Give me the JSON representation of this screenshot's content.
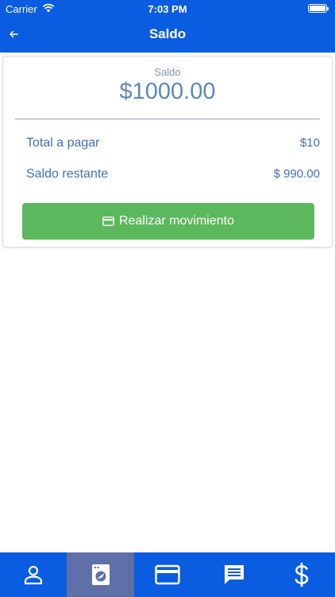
{
  "status_bar": {
    "carrier": "Carrier",
    "time": "7:03 PM"
  },
  "nav": {
    "title": "Saldo"
  },
  "balance": {
    "label": "Saldo",
    "value": "$1000.00"
  },
  "rows": [
    {
      "label": "Total a pagar",
      "value": "$10"
    },
    {
      "label": "Saldo restante",
      "value": "$ 990.00"
    }
  ],
  "action": {
    "label": "Realizar movimiento",
    "icon": "credit-card-icon"
  },
  "tabbar": {
    "active_index": 1,
    "items": [
      {
        "icon": "person-icon"
      },
      {
        "icon": "washing-machine-icon"
      },
      {
        "icon": "credit-card-icon"
      },
      {
        "icon": "chat-icon"
      },
      {
        "icon": "dollar-icon"
      }
    ]
  },
  "colors": {
    "primary": "#0a5ce0",
    "tab_active": "#5f6fa8",
    "success": "#5cb85c",
    "text_blue": "#3f6fb6"
  }
}
